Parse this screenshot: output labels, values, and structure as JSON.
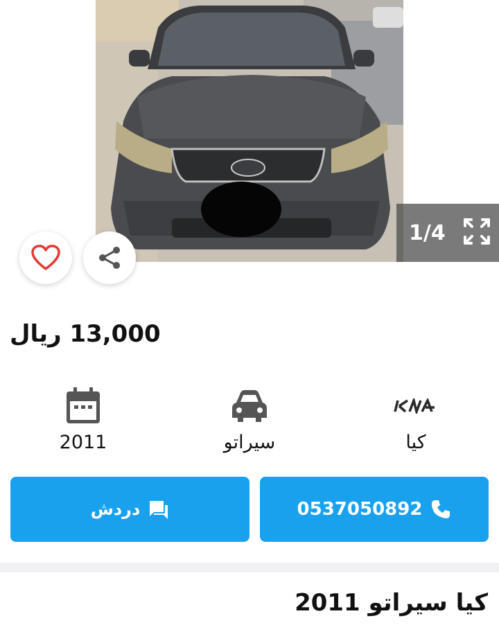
{
  "gallery": {
    "counter": "1/4",
    "prev_icon": "chevron-left-icon",
    "next_icon": "chevron-right-icon",
    "fullscreen_icon": "fullscreen-icon"
  },
  "actions": {
    "favorite_icon": "heart-icon",
    "share_icon": "share-icon"
  },
  "listing": {
    "price": "13,000 ريال",
    "title": "كيا سيراتو 2011"
  },
  "specs": {
    "year": "2011",
    "model": "سيراتو",
    "make": "كيا",
    "year_icon": "calendar-icon",
    "model_icon": "car-icon",
    "make_icon": "kia-logo"
  },
  "contact": {
    "chat_label": "دردش",
    "phone": "0537050892"
  },
  "colors": {
    "button_blue": "#1aa1ee",
    "heart_red": "#e53935"
  }
}
